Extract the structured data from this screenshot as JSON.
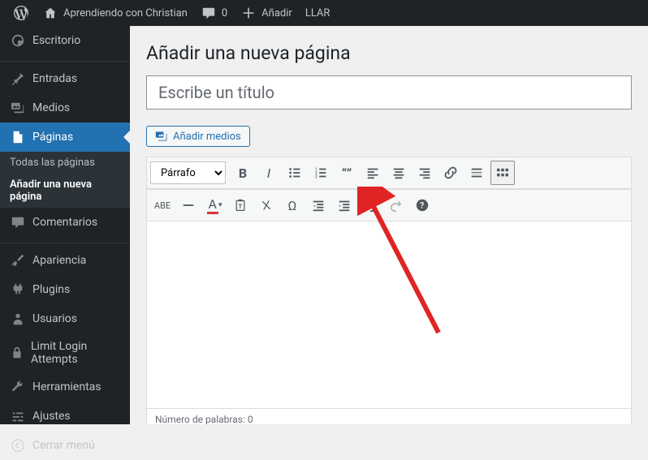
{
  "adminbar": {
    "site_name": "Aprendiendo con Christian",
    "comments_count": "0",
    "add_new": "Añadir",
    "llar": "LLAR"
  },
  "sidebar": {
    "dashboard": "Escritorio",
    "posts": "Entradas",
    "media": "Medios",
    "pages": "Páginas",
    "pages_sub_all": "Todas las páginas",
    "pages_sub_new": "Añadir una nueva página",
    "comments": "Comentarios",
    "appearance": "Apariencia",
    "plugins": "Plugins",
    "users": "Usuarios",
    "limit_login": "Limit Login Attempts",
    "tools": "Herramientas",
    "settings": "Ajustes",
    "collapse": "Cerrar menú"
  },
  "main": {
    "heading": "Añadir una nueva página",
    "title_placeholder": "Escribe un título",
    "add_media": "Añadir medios",
    "format_select": "Párrafo",
    "word_count": "Número de palabras: 0"
  }
}
